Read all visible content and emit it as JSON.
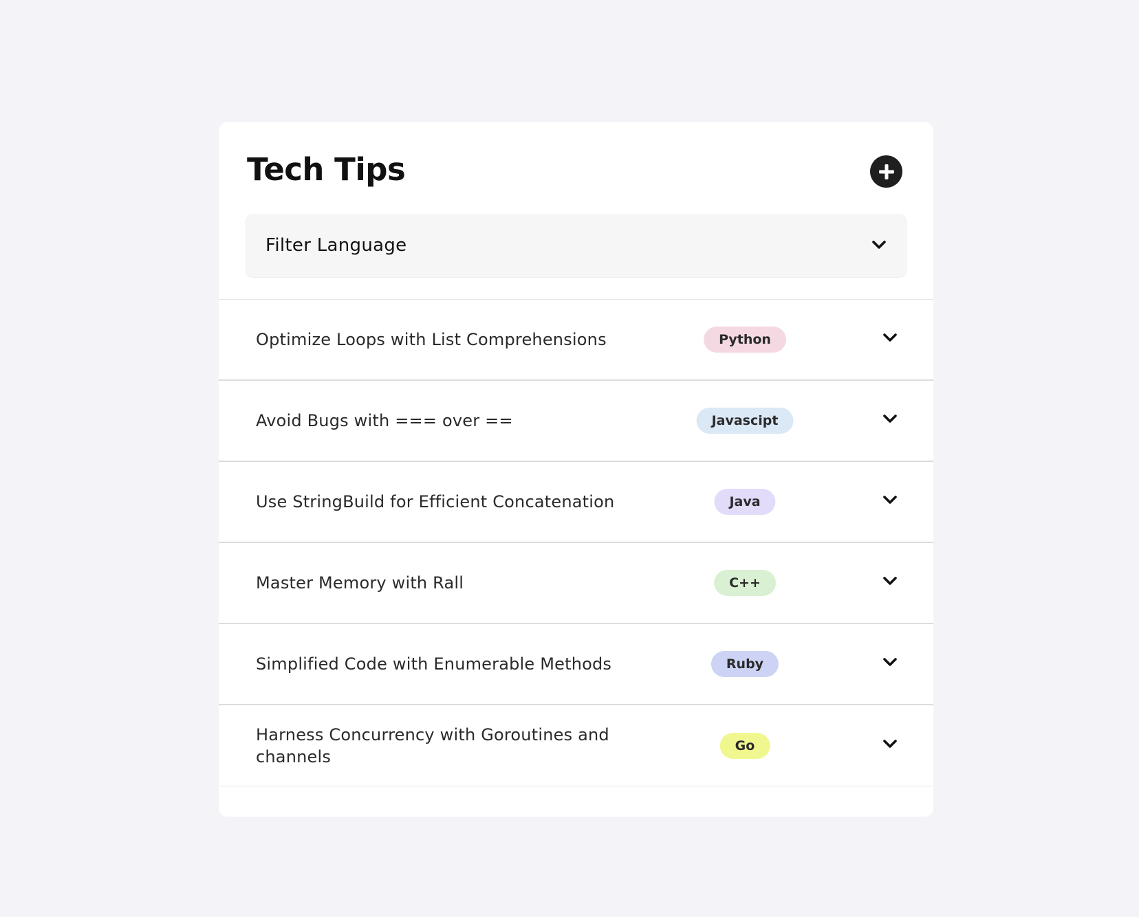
{
  "header": {
    "title": "Tech Tips",
    "add_icon": "plus-icon"
  },
  "filter": {
    "label": "Filter Language",
    "chevron_icon": "chevron-down-icon"
  },
  "tips": [
    {
      "title": "Optimize Loops with List Comprehensions",
      "language": "Python",
      "badge_color": "#f5d9e2"
    },
    {
      "title": "Avoid Bugs with === over ==",
      "language": "Javascipt",
      "badge_color": "#dbe8f6"
    },
    {
      "title": "Use StringBuild for Efficient Concatenation",
      "language": "Java",
      "badge_color": "#e3dbfa"
    },
    {
      "title": "Master Memory with Rall",
      "language": "C++",
      "badge_color": "#daf0d2"
    },
    {
      "title": "Simplified Code with Enumerable Methods",
      "language": "Ruby",
      "badge_color": "#ccd3f5"
    },
    {
      "title": "Harness Concurrency with Goroutines and channels",
      "language": "Go",
      "badge_color": "#f1f78f"
    }
  ],
  "colors": {
    "page_background": "#f4f4f8",
    "card_background": "#ffffff",
    "accent_dark": "#1f1f1f"
  }
}
